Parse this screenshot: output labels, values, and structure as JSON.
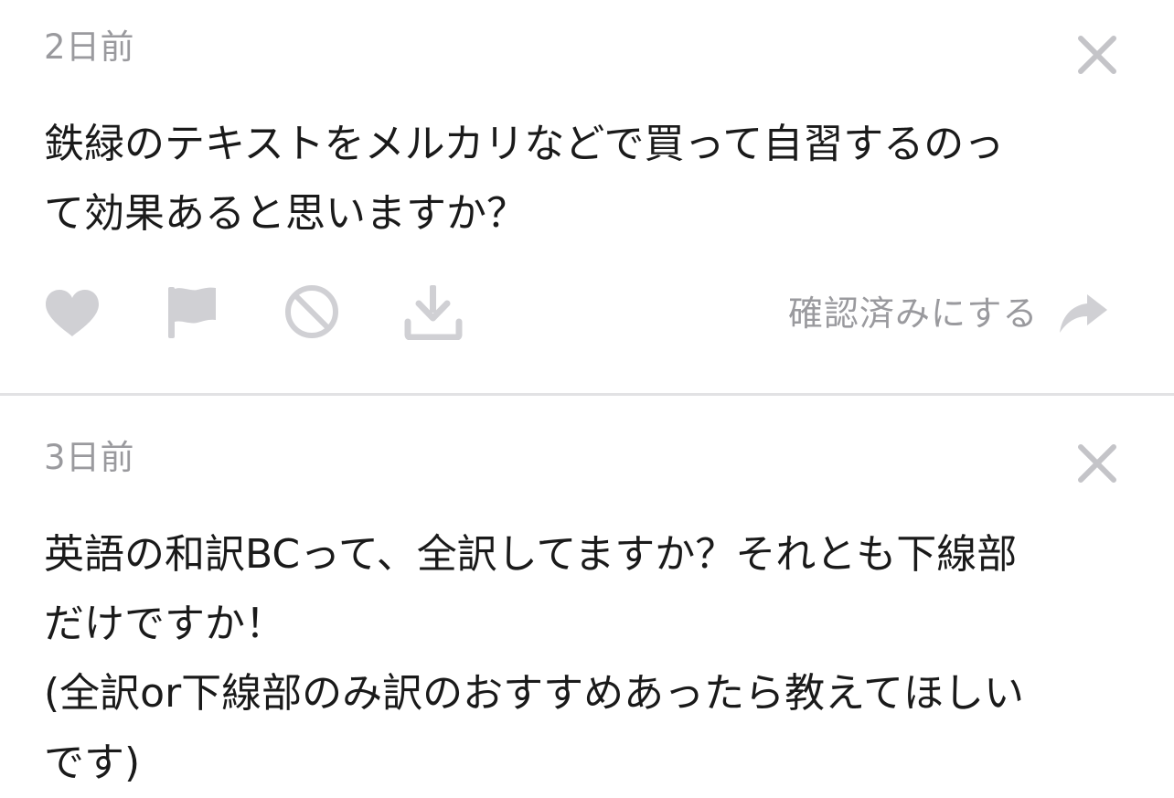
{
  "posts": [
    {
      "timestamp": "2日前",
      "message": "鉄緑のテキストをメルカリなどで買って自習するのっ\nて効果あると思いますか？",
      "confirm_label": "確認済みにする"
    },
    {
      "timestamp": "3日前",
      "message": "英語の和訳BCって、全訳してますか？それとも下線部\nだけですか！\n(全訳or下線部のみ訳のおすすめあったら教えてほしい\nです)"
    }
  ],
  "colors": {
    "icon_gray": "#d0d0d4",
    "text_gray": "#9a9a9e",
    "text_main": "#1a1a1a",
    "divider": "#e2e2e4"
  },
  "icons": {
    "close": "close-icon",
    "like": "heart-icon",
    "report": "flag-icon",
    "block": "block-icon",
    "save": "download-icon",
    "confirm": "reply-arrow-icon"
  }
}
